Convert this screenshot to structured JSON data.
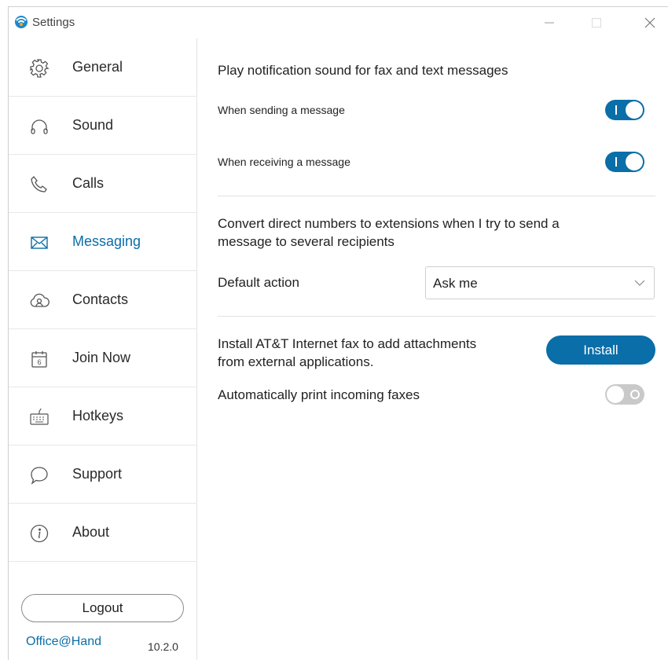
{
  "window": {
    "title": "Settings",
    "icons": {
      "app": "app-logo-icon",
      "minimize": "minimize-icon",
      "maximize": "maximize-icon",
      "close": "close-icon"
    }
  },
  "sidebar": {
    "items": [
      {
        "label": "General",
        "icon": "gear-icon",
        "active": false
      },
      {
        "label": "Sound",
        "icon": "headphones-icon",
        "active": false
      },
      {
        "label": "Calls",
        "icon": "phone-icon",
        "active": false
      },
      {
        "label": "Messaging",
        "icon": "envelope-icon",
        "active": true
      },
      {
        "label": "Contacts",
        "icon": "cloud-contacts-icon",
        "active": false
      },
      {
        "label": "Join Now",
        "icon": "calendar-icon",
        "active": false
      },
      {
        "label": "Hotkeys",
        "icon": "keyboard-icon",
        "active": false
      },
      {
        "label": "Support",
        "icon": "chat-bubble-icon",
        "active": false
      },
      {
        "label": "About",
        "icon": "info-icon",
        "active": false
      }
    ],
    "logout_label": "Logout",
    "brand": "Office@Hand",
    "version": "10.2.0"
  },
  "messaging": {
    "sound_heading": "Play notification sound for fax and text messages",
    "when_sending_label": "When sending a message",
    "when_sending_on": true,
    "when_receiving_label": "When receiving a message",
    "when_receiving_on": true,
    "convert_heading_line1": "Convert direct numbers to extensions when I try to send a",
    "convert_heading_line2": "message to several recipients",
    "default_action_label": "Default action",
    "default_action_value": "Ask me",
    "install_text_line1": "Install AT&T Internet fax to add attachments",
    "install_text_line2": "from external applications.",
    "install_button_label": "Install",
    "auto_print_label": "Automatically print incoming faxes",
    "auto_print_on": false
  },
  "colors": {
    "accent": "#0a6ea8",
    "toggle_off": "#c9c9c9",
    "divider": "#e2e2e2"
  }
}
